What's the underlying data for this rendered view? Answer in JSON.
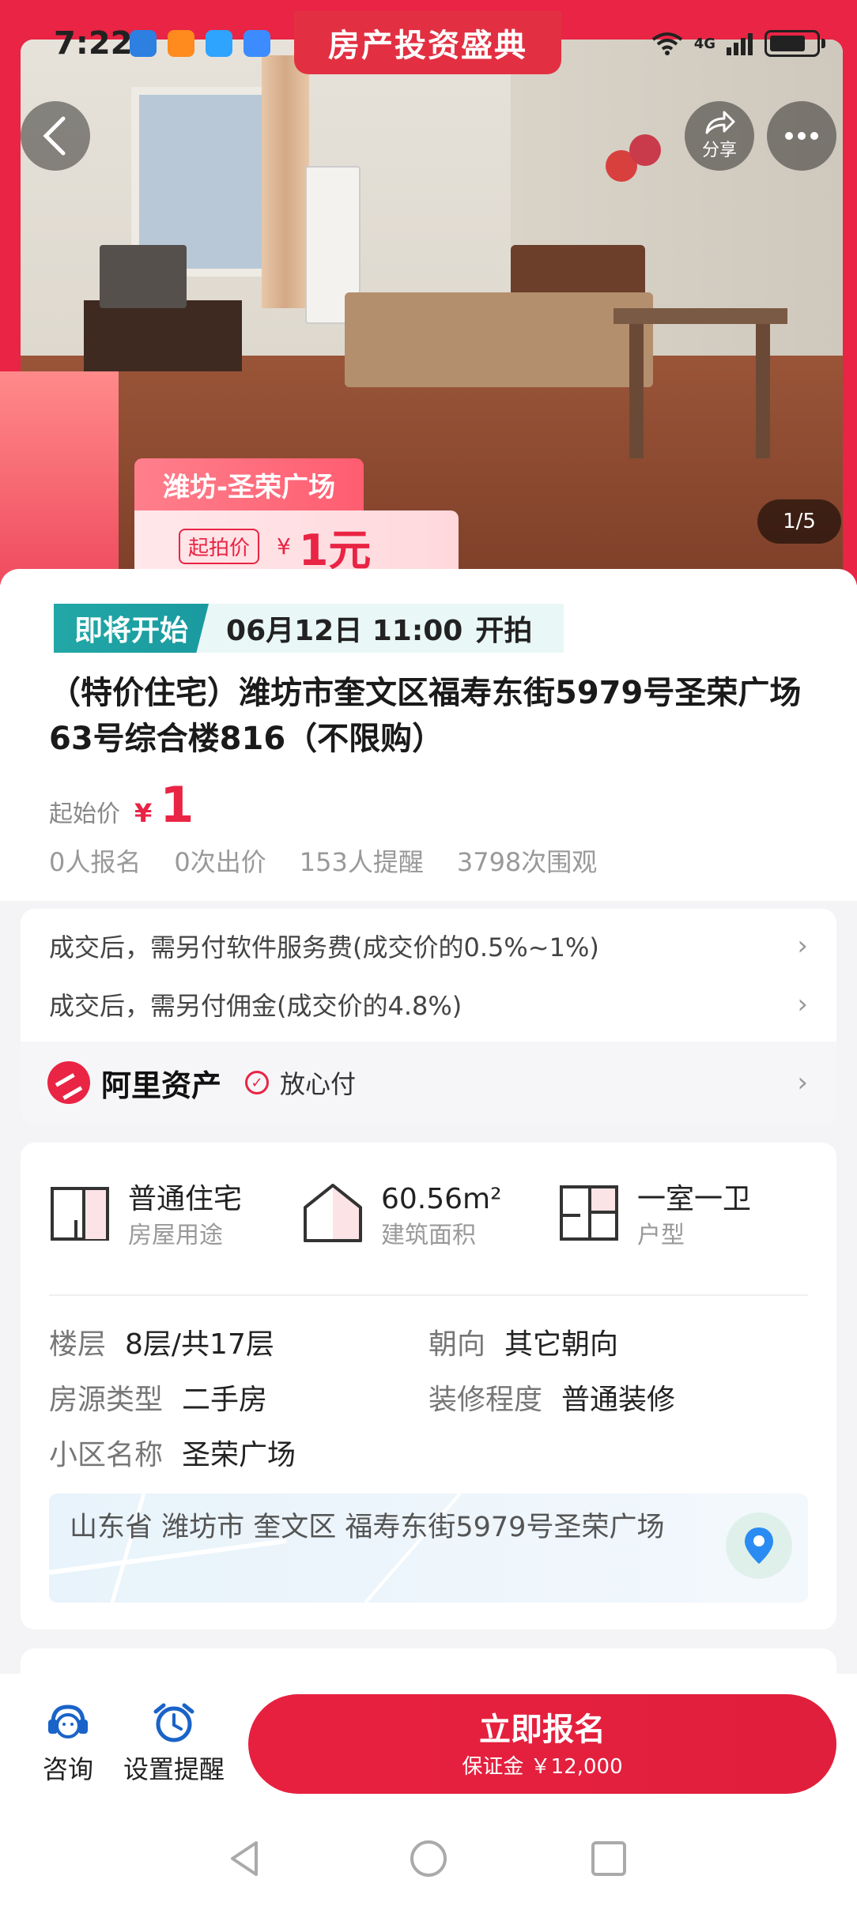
{
  "status_bar": {
    "time": "7:22",
    "network": "4G"
  },
  "event_banner": "房产投资盛典",
  "hero": {
    "share_label": "分享",
    "counter": "1/5",
    "promo_location": "潍坊-圣荣广场",
    "promo_tag": "起拍价",
    "promo_currency": "¥",
    "promo_price": "1元"
  },
  "auction": {
    "status": "即将开始",
    "time": "06月12日 11:00",
    "time_suffix": "开拍",
    "title": "（特价住宅）潍坊市奎文区福寿东街5979号圣荣广场63号综合楼816（不限购）",
    "price_label": "起始价",
    "price_currency": "¥",
    "price_value": "1",
    "stats": [
      "0人报名",
      "0次出价",
      "153人提醒",
      "3798次围观"
    ]
  },
  "fees": {
    "service_fee": "成交后，需另付软件服务费(成交价的0.5%~1%)",
    "commission": "成交后，需另付佣金(成交价的4.8%)",
    "platform_name": "阿里资产",
    "safe_pay": "放心付"
  },
  "specs": [
    {
      "value": "普通住宅",
      "label": "房屋用途",
      "icon": "house-use-icon"
    },
    {
      "value": "60.56m²",
      "label": "建筑面积",
      "icon": "area-icon"
    },
    {
      "value": "一室一卫",
      "label": "户型",
      "icon": "floorplan-icon"
    }
  ],
  "attributes": {
    "floor_k": "楼层",
    "floor_v": "8层/共17层",
    "orientation_k": "朝向",
    "orientation_v": "其它朝向",
    "type_k": "房源类型",
    "type_v": "二手房",
    "decor_k": "装修程度",
    "decor_v": "普通装修",
    "community_k": "小区名称",
    "community_v": "圣荣广场"
  },
  "address": "山东省 潍坊市 奎文区 福寿东街5979号圣荣广场",
  "actions": {
    "consult": "咨询",
    "remind": "设置提醒",
    "signup": "立即报名",
    "deposit": "保证金 ￥12,000"
  },
  "colors": {
    "accent": "#e92444",
    "teal": "#22a7a6"
  }
}
